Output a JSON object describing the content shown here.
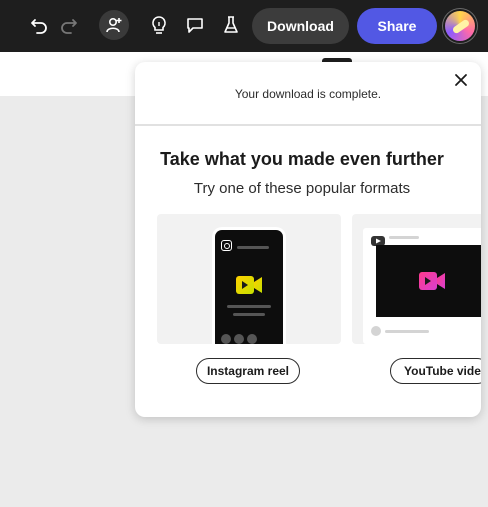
{
  "toolbar": {
    "icons": [
      "undo-icon",
      "redo-icon",
      "invite-icon",
      "lightbulb-icon",
      "comment-icon",
      "beaker-icon"
    ],
    "download_label": "Download",
    "share_label": "Share",
    "accent_color": "#5258e4"
  },
  "panel": {
    "status": "Your download is complete.",
    "heading": "Take what you made even further",
    "subheading": "Try one of these popular formats",
    "formats": [
      {
        "label": "Instagram reel",
        "icon": "instagram-icon"
      },
      {
        "label": "YouTube video",
        "icon": "youtube-icon"
      }
    ]
  }
}
